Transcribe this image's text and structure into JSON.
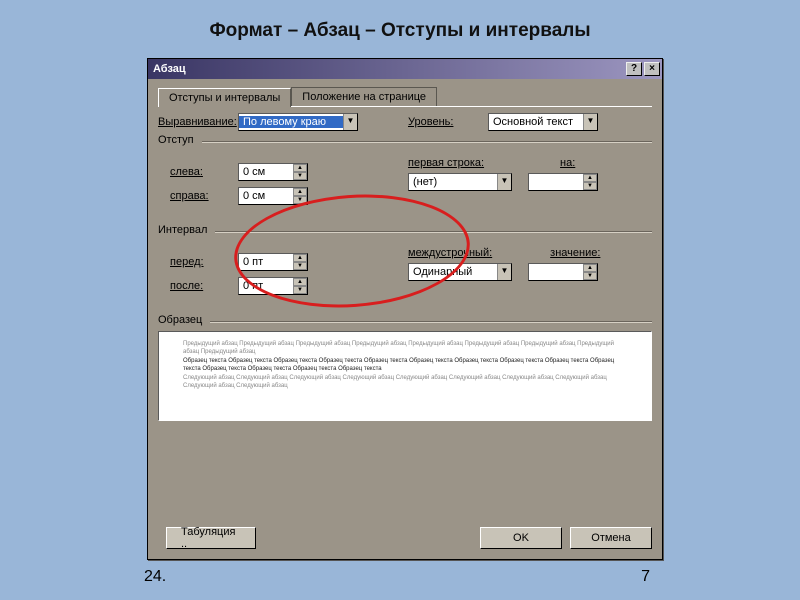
{
  "slide": {
    "title": "Формат – Абзац – Отступы и интервалы"
  },
  "footer": {
    "left": "24.",
    "right": "7"
  },
  "dialog": {
    "title": "Абзац",
    "help_btn": "?",
    "close_btn": "×",
    "tabs": {
      "active": "Отступы и интервалы",
      "inactive": "Положение на странице"
    },
    "alignment": {
      "label": "Выравнивание:",
      "value": "По левому краю",
      "level_label": "Уровень:",
      "level_value": "Основной текст"
    },
    "indent": {
      "group": "Отступ",
      "left_label": "слева:",
      "left_value": "0 см",
      "right_label": "справа:",
      "right_value": "0 см",
      "firstline_label": "первая строка:",
      "firstline_value": "(нет)",
      "by_label": "на:"
    },
    "spacing": {
      "group": "Интервал",
      "before_label": "перед:",
      "before_value": "0 пт",
      "after_label": "после:",
      "after_value": "0 пт",
      "line_label": "междустрочный:",
      "line_value": "Одинарный",
      "at_label": "значение:"
    },
    "preview": {
      "group": "Образец",
      "faint1": "Предыдущий абзац Предыдущий абзац Предыдущий абзац Предыдущий абзац Предыдущий абзац Предыдущий абзац Предыдущий абзац Предыдущий абзац Предыдущий абзац",
      "dark": "Образец текста Образец текста Образец текста Образец текста Образец текста Образец текста Образец текста Образец текста Образец текста Образец текста Образец текста Образец текста Образец текста Образец текста",
      "faint2": "Следующий абзац Следующий абзац Следующий абзац Следующий абзац Следующий абзац Следующий абзац Следующий абзац Следующий абзац Следующий абзац Следующий абзац"
    },
    "buttons": {
      "tabs": "Табуляция ..",
      "ok": "OK",
      "cancel": "Отмена"
    }
  }
}
